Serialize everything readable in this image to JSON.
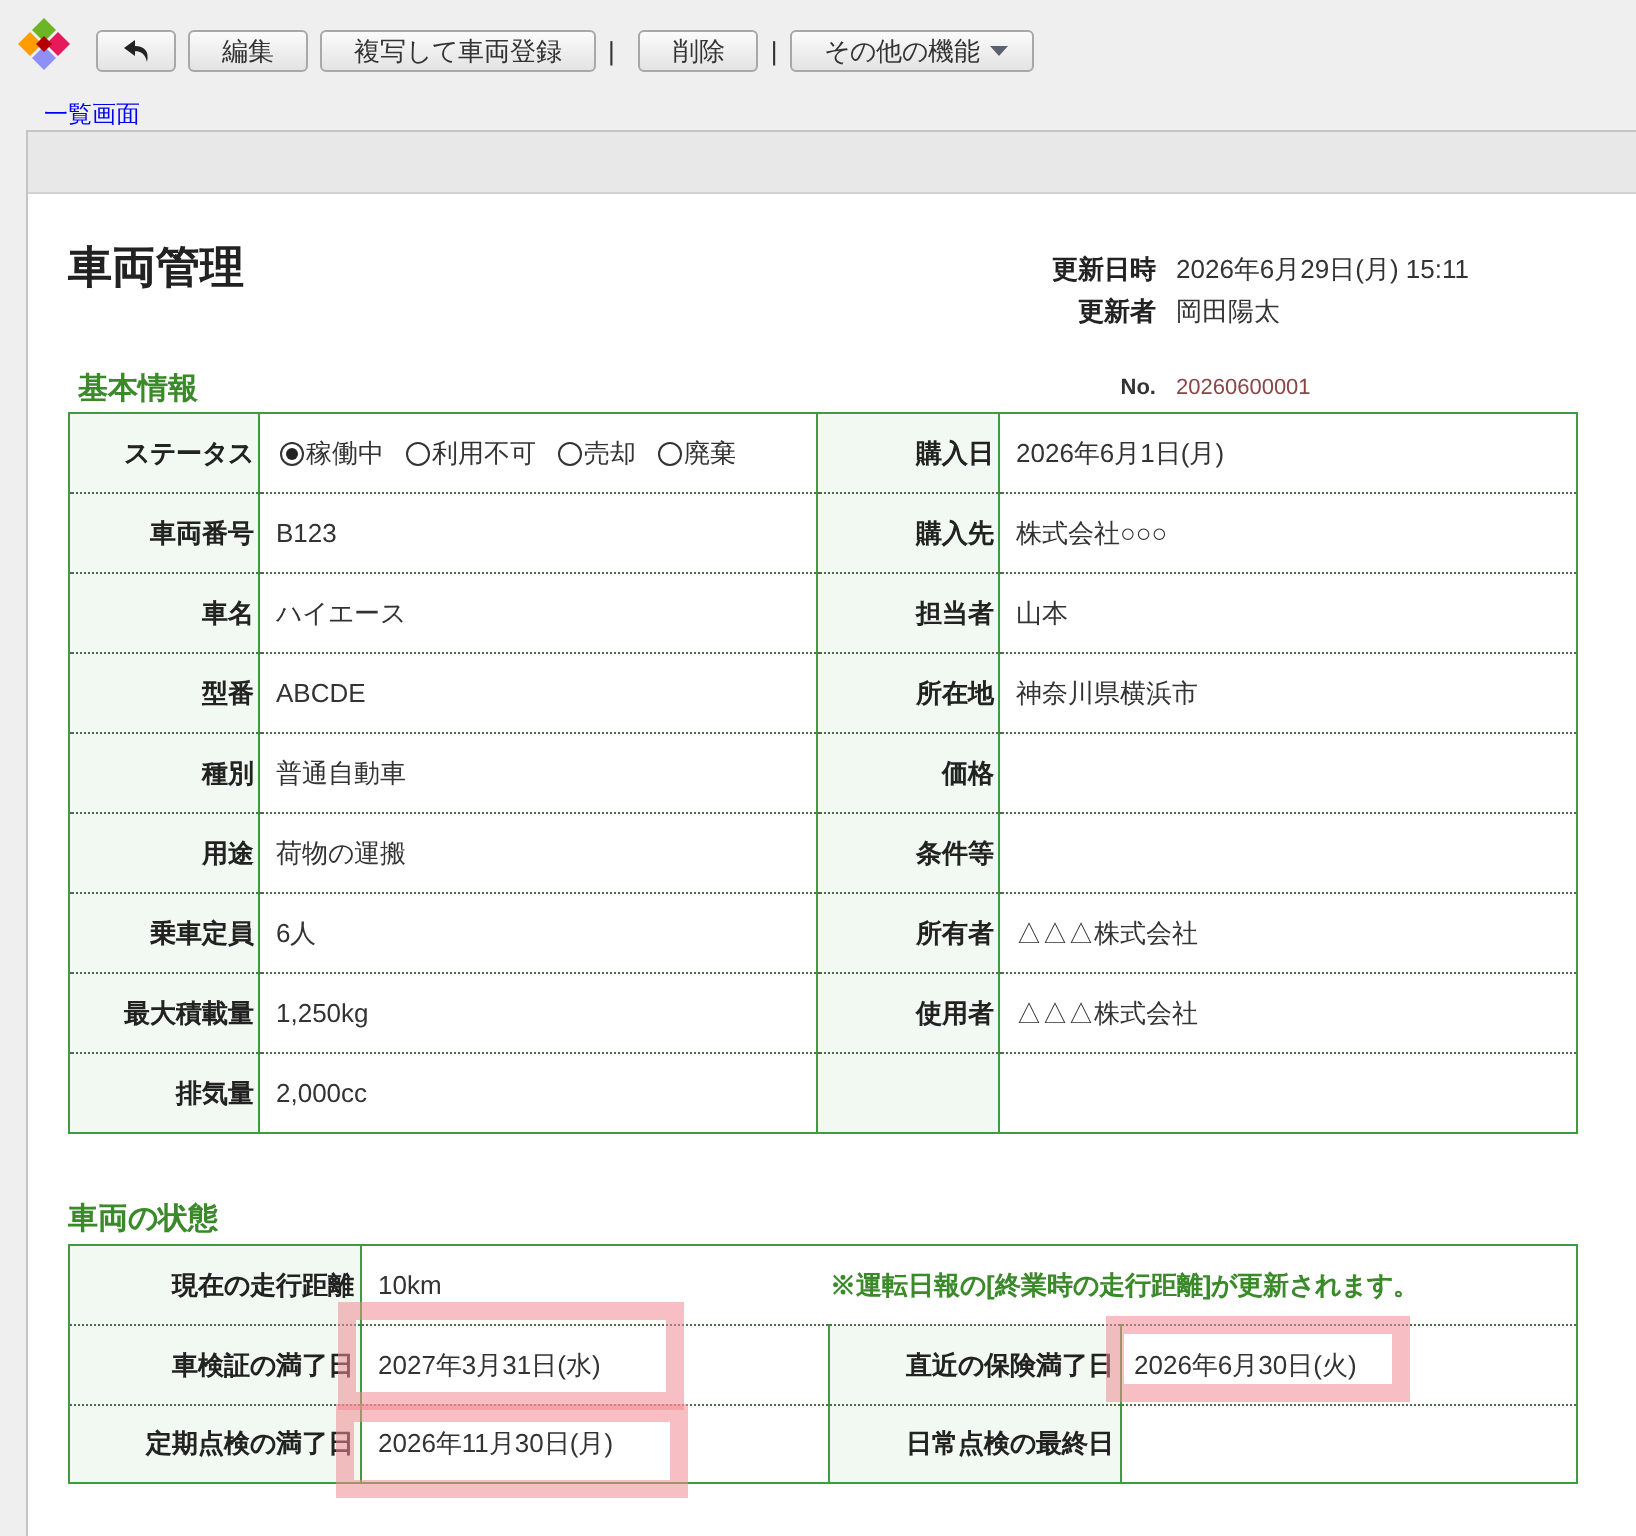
{
  "toolbar": {
    "items": [
      {
        "kind": "back"
      },
      {
        "kind": "button",
        "label": "編集"
      },
      {
        "kind": "button",
        "label": "複写して車両登録"
      },
      {
        "kind": "separator",
        "label": "|"
      },
      {
        "kind": "button",
        "label": "削除"
      },
      {
        "kind": "separator",
        "label": "|"
      },
      {
        "kind": "dropdown",
        "label": "その他の機能"
      }
    ]
  },
  "link": "一覧画面",
  "header": {
    "title": "車両管理",
    "meta": [
      {
        "label": "更新日時",
        "value": "2026年6月29日(月) 15:11"
      },
      {
        "label": "更新者",
        "value": "岡田陽太"
      }
    ]
  },
  "basic_info": {
    "heading": "基本情報",
    "number_label": "No.",
    "number": "20260600001",
    "rows": [
      {
        "left": {
          "kind": "radio",
          "label": "ステータス",
          "options": [
            {
              "label": "稼働中",
              "selected": true
            },
            {
              "label": "利用不可",
              "selected": false
            },
            {
              "label": "売却",
              "selected": false
            },
            {
              "label": "廃棄",
              "selected": false
            }
          ]
        },
        "right": {
          "kind": "text",
          "label": "購入日",
          "value": "2026年6月1日(月)"
        }
      },
      {
        "left": {
          "kind": "text",
          "label": "車両番号",
          "value": "B123"
        },
        "right": {
          "kind": "text",
          "label": "購入先",
          "value": "株式会社○○○"
        }
      },
      {
        "left": {
          "kind": "text",
          "label": "車名",
          "value": "ハイエース"
        },
        "right": {
          "kind": "text",
          "label": "担当者",
          "value": "山本"
        }
      },
      {
        "left": {
          "kind": "text",
          "label": "型番",
          "value": "ABCDE"
        },
        "right": {
          "kind": "text",
          "label": "所在地",
          "value": "神奈川県横浜市"
        }
      },
      {
        "left": {
          "kind": "text",
          "label": "種別",
          "value": "普通自動車"
        },
        "right": {
          "kind": "text",
          "label": "価格"
        }
      },
      {
        "left": {
          "kind": "text",
          "label": "用途",
          "value": "荷物の運搬"
        },
        "right": {
          "kind": "text",
          "label": "条件等"
        }
      },
      {
        "left": {
          "kind": "text",
          "label": "乗車定員",
          "value": "6人"
        },
        "right": {
          "kind": "text",
          "label": "所有者",
          "value": "△△△株式会社"
        }
      },
      {
        "left": {
          "kind": "text",
          "label": "最大積載量",
          "value": "1,250kg"
        },
        "right": {
          "kind": "text",
          "label": "使用者",
          "value": "△△△株式会社"
        }
      },
      {
        "left": {
          "kind": "text",
          "label": "排気量",
          "value": "2,000cc"
        }
      }
    ]
  },
  "vehicle_status": {
    "heading": "車両の状態",
    "rows": [
      {
        "cells": [
          {
            "label": "現在の走行距離",
            "value": "10km",
            "note": "※運転日報の[終業時の走行距離]が更新されます。",
            "highlighted": false
          }
        ]
      },
      {
        "cells": [
          {
            "label": "車検証の満了日",
            "value": "2027年3月31日(水)",
            "highlighted": true
          },
          {
            "label": "直近の保険満了日",
            "value": "2026年6月30日(火)",
            "highlighted": true
          }
        ]
      },
      {
        "cells": [
          {
            "label": "定期点検の満了日",
            "value": "2026年11月30日(月)",
            "highlighted": true
          },
          {
            "label": "日常点検の最終日",
            "highlighted": false
          }
        ]
      }
    ]
  }
}
